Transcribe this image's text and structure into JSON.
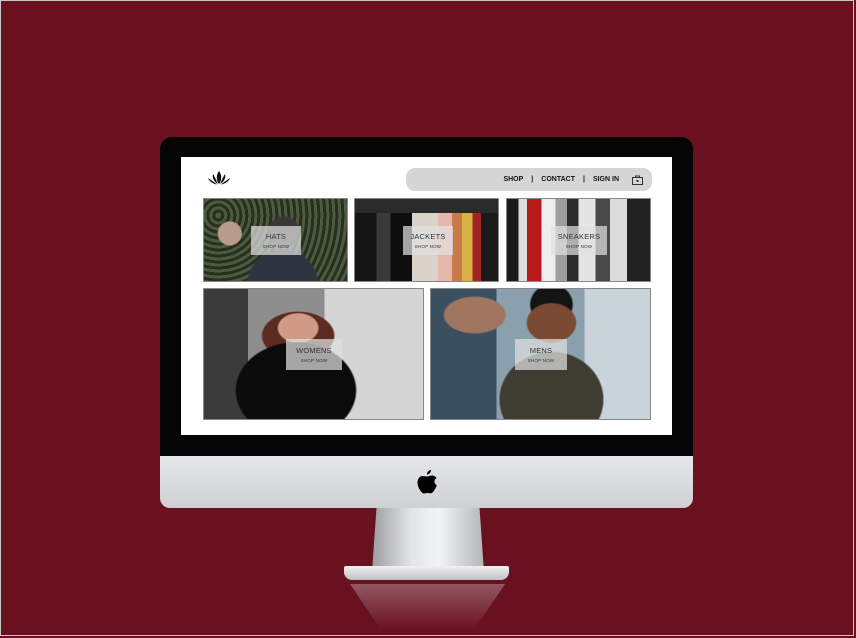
{
  "colors": {
    "background": "#6a1120",
    "navbar": "#d6d6d6",
    "screen": "#ffffff"
  },
  "header": {
    "logo_icon": "lotus-icon",
    "nav": {
      "shop": "SHOP",
      "contact": "CONTACT",
      "signin": "SIGN IN",
      "separator": "|"
    },
    "cart_icon": "cart-icon"
  },
  "tiles": {
    "hats": {
      "title": "HATS",
      "cta": "SHOP NOW"
    },
    "jackets": {
      "title": "JACKETS",
      "cta": "SHOP NOW"
    },
    "sneakers": {
      "title": "SNEAKERS",
      "cta": "SHOP NOW"
    },
    "womens": {
      "title": "WOMENS",
      "cta": "SHOP NOW"
    },
    "mens": {
      "title": "MENS",
      "cta": "SHOP NOW"
    }
  },
  "device": {
    "brand_icon": "apple-icon"
  }
}
